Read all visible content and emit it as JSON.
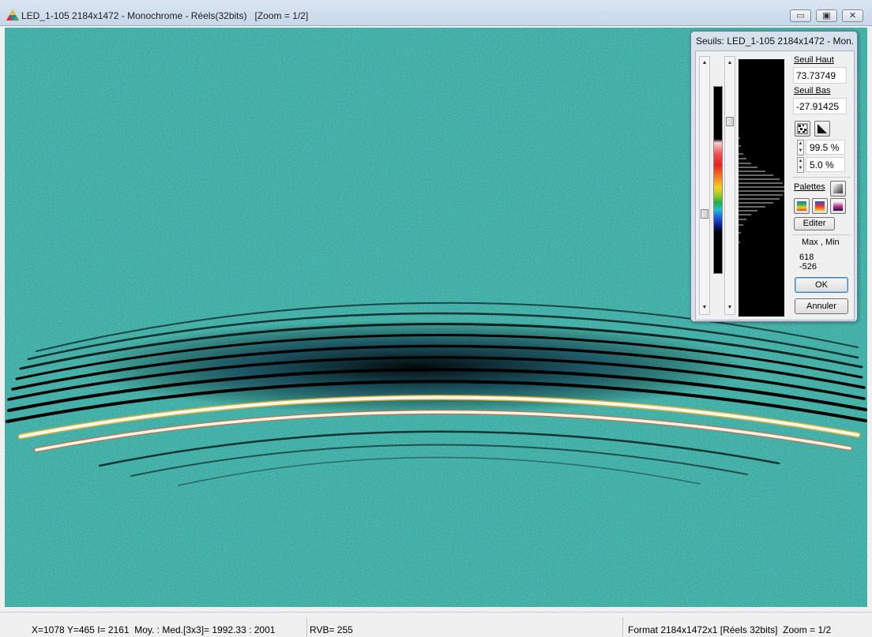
{
  "window": {
    "title": "LED_1-105 2184x1472 - Monochrome - Réels(32bits)   [Zoom = 1/2]",
    "icon": "triangle-prism-icon",
    "minimize_glyph": "▭",
    "maximize_glyph": "▣",
    "close_glyph": "✕"
  },
  "image": {
    "description_colors": {
      "background": "#1f8f86",
      "noise_blue": "#1a6fb0",
      "noise_green": "#4fbf4a",
      "noise_yellow": "#c8d63a",
      "dark_bands": "#000000",
      "bright_bands": "#fff4ea"
    }
  },
  "dialog": {
    "title": "Seuils: LED_1-105 2184x1472 - Mon...",
    "seuil_haut_label": "Seuil Haut",
    "seuil_haut_value": "73.73749",
    "seuil_bas_label": "Seuil Bas",
    "seuil_bas_value": "-27.91425",
    "pct_high": "99.5 %",
    "pct_low": "5.0 %",
    "palettes_label": "Palettes",
    "edit_label": "Editer",
    "maxmin_label": "Max , Min",
    "max_value": "618",
    "min_value": "-526",
    "ok_label": "OK",
    "cancel_label": "Annuler"
  },
  "status": {
    "coords": "X=1078 Y=465 I= 2161  Moy. : Med.[3x3]= 1992.33 : 2001",
    "rgb": "RVB= 255",
    "format": "Format 2184x1472x1 [Réels 32bits]  Zoom = 1/2"
  }
}
